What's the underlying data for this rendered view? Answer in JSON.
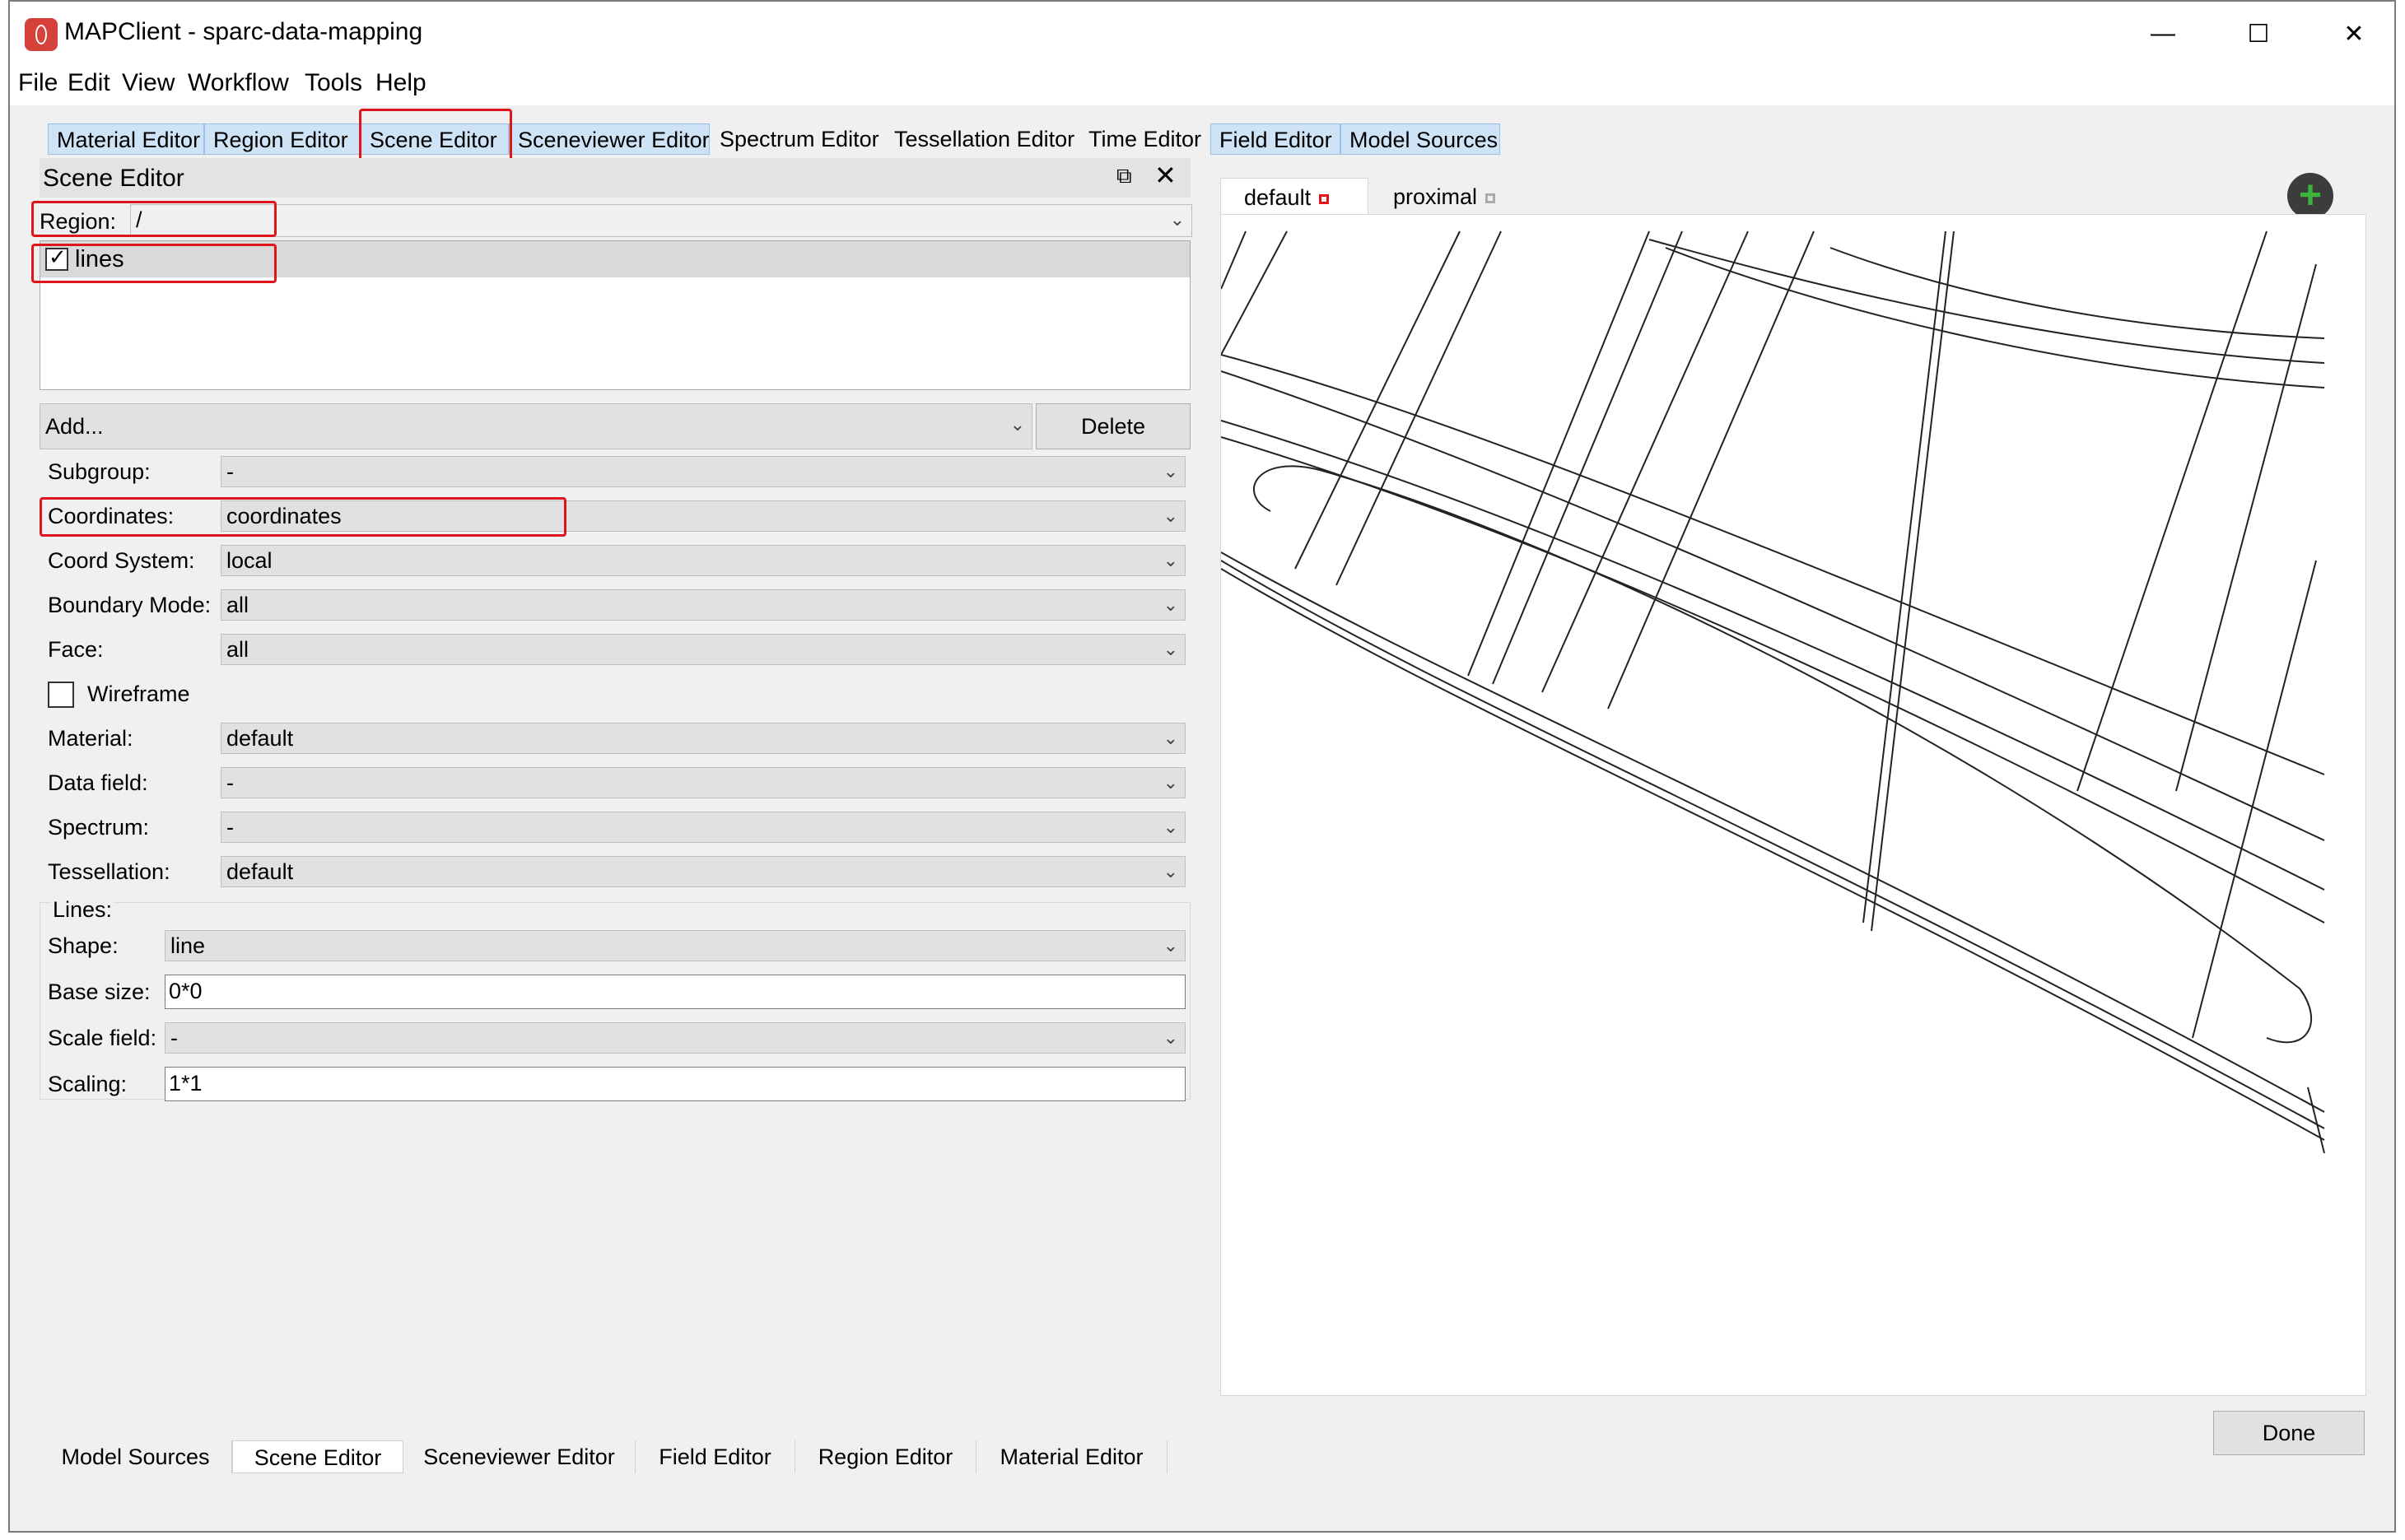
{
  "window": {
    "title": "MAPClient - sparc-data-mapping",
    "controls": {
      "minimize": "—",
      "maximize": "☐",
      "close": "✕"
    }
  },
  "menu": [
    "File",
    "Edit",
    "View",
    "Workflow",
    "Tools",
    "Help"
  ],
  "top_tabs": [
    {
      "label": "Material Editor",
      "style": "blue"
    },
    {
      "label": "Region Editor",
      "style": "blue"
    },
    {
      "label": "Scene Editor",
      "style": "blue",
      "highlighted": true
    },
    {
      "label": "Sceneviewer Editor",
      "style": "blue"
    },
    {
      "label": "Spectrum Editor",
      "style": "plain"
    },
    {
      "label": "Tessellation Editor",
      "style": "plain"
    },
    {
      "label": "Time Editor",
      "style": "plain"
    },
    {
      "label": "Field Editor",
      "style": "blue"
    },
    {
      "label": "Model Sources",
      "style": "blue"
    }
  ],
  "scene_editor": {
    "title": "Scene Editor",
    "region_label": "Region:",
    "region_value": "/",
    "graphics_items": [
      {
        "label": "lines",
        "checked": true
      }
    ],
    "add_label": "Add...",
    "delete_label": "Delete",
    "fields": {
      "subgroup": {
        "label": "Subgroup:",
        "value": "-"
      },
      "coordinates": {
        "label": "Coordinates:",
        "value": "coordinates"
      },
      "coord_system": {
        "label": "Coord System:",
        "value": "local"
      },
      "boundary_mode": {
        "label": "Boundary Mode:",
        "value": "all"
      },
      "face": {
        "label": "Face:",
        "value": "all"
      },
      "wireframe": {
        "label": "Wireframe",
        "checked": false
      },
      "material": {
        "label": "Material:",
        "value": "default"
      },
      "data_field": {
        "label": "Data field:",
        "value": "-"
      },
      "spectrum": {
        "label": "Spectrum:",
        "value": "-"
      },
      "tessellation": {
        "label": "Tessellation:",
        "value": "default"
      }
    },
    "lines_section": {
      "title": "Lines:",
      "shape": {
        "label": "Shape:",
        "value": "line"
      },
      "base_size": {
        "label": "Base size:",
        "value": "0*0"
      },
      "scale_field": {
        "label": "Scale field:",
        "value": "-"
      },
      "scaling": {
        "label": "Scaling:",
        "value": "1*1"
      }
    }
  },
  "viewer_tabs": [
    "default",
    "proximal"
  ],
  "done_label": "Done",
  "bottom_tabs": [
    "Model Sources",
    "Scene Editor",
    "Sceneviewer Editor",
    "Field Editor",
    "Region Editor",
    "Material Editor"
  ],
  "colors": {
    "highlight": "#e0141b",
    "tab_blue": "#cfe3f7",
    "add_icon": "#2f9a2f"
  }
}
